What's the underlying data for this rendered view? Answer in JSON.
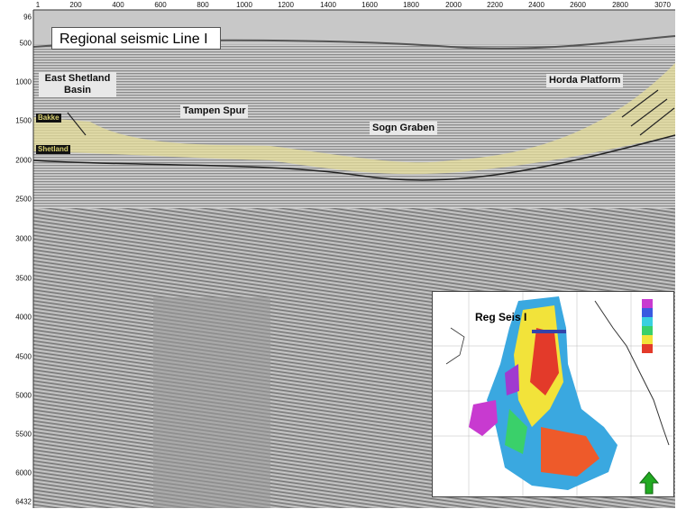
{
  "title": "Regional seismic Line I",
  "top_axis_ticks": [
    "1",
    "200",
    "400",
    "600",
    "800",
    "1000",
    "1200",
    "1400",
    "1600",
    "1800",
    "2000",
    "2200",
    "2400",
    "2600",
    "2800",
    "3070"
  ],
  "left_axis_ticks": [
    "96",
    "500",
    "1000",
    "1500",
    "2000",
    "2500",
    "3000",
    "3500",
    "4000",
    "4500",
    "5000",
    "5500",
    "6000",
    "6432"
  ],
  "regions": {
    "east_shetland": "East Shetland\nBasin",
    "tampen_spur": "Tampen Spur",
    "sogn_graben": "Sogn Graben",
    "horda_platform": "Horda Platform"
  },
  "horizons": {
    "top": "Bakke",
    "base": "Shetland"
  },
  "inset": {
    "label": "Reg Seis I",
    "north_arrow": "arrow-up-icon"
  },
  "colors": {
    "seismic_background": "#a9a9a9",
    "horizon_band": "#e6dd9a",
    "inset_line": "#3344aa",
    "north_arrow": "#22aa22"
  }
}
